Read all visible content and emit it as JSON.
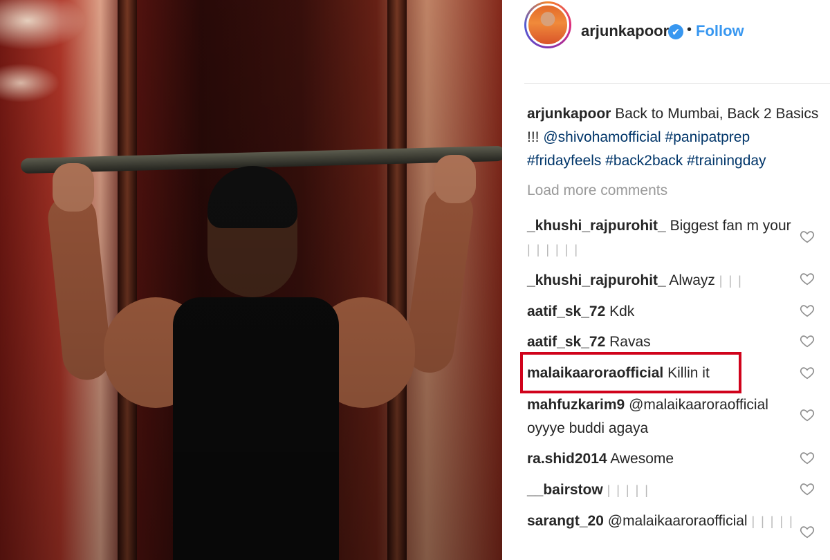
{
  "post": {
    "username": "arjunkapoor",
    "verified_mark": "✔",
    "separator": "•",
    "follow_label": "Follow",
    "caption": {
      "username": "arjunkapoor",
      "text": "Back to Mumbai, Back 2 Basics !!!",
      "mention": "@shivohamofficial",
      "tags": "#panipatprep #fridayfeels #back2back #trainingday"
    },
    "load_more_label": "Load more comments"
  },
  "comments": [
    {
      "user": "_khushi_rajpurohit_",
      "text": "Biggest fan m your",
      "extra": "| | | | | |"
    },
    {
      "user": "_khushi_rajpurohit_",
      "text": "Alwayz",
      "extra": "| | |"
    },
    {
      "user": "aatif_sk_72",
      "text": "Kdk",
      "extra": ""
    },
    {
      "user": "aatif_sk_72",
      "text": "Ravas",
      "extra": ""
    },
    {
      "user": "malaikaaroraofficial",
      "text": "Killin it",
      "extra": ""
    },
    {
      "user": "mahfuzkarim9",
      "text": "@malaikaaroraofficial oyyye buddi agaya",
      "extra": ""
    },
    {
      "user": "ra.shid2014",
      "text": "Awesome",
      "extra": ""
    },
    {
      "user": "__bairstow",
      "text": "",
      "extra": "| | | | |"
    },
    {
      "user": "sarangt_20",
      "text": "@malaikaaroraofficial",
      "extra": "| | | | |"
    }
  ],
  "colors": {
    "link": "#3897f0",
    "hashtag": "#003569",
    "highlight_border": "#d0021b",
    "muted": "#999999"
  },
  "icons": {
    "verified": "verified-badge-icon",
    "like": "heart-outline-icon"
  }
}
